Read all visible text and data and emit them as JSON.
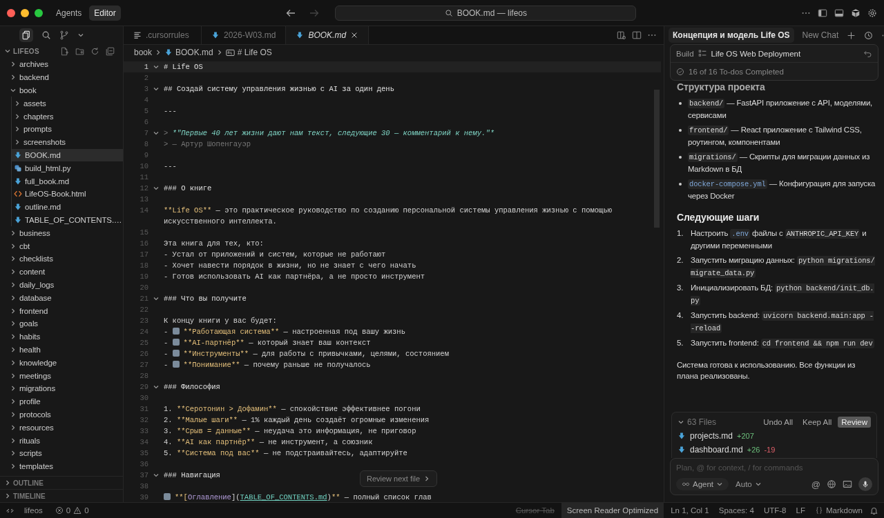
{
  "titlebar": {
    "modes": [
      {
        "label": "Agents",
        "selected": false
      },
      {
        "label": "Editor",
        "selected": true
      }
    ],
    "search": {
      "value": "BOOK.md — lifeos"
    }
  },
  "sidebar": {
    "root": "LIFEOS",
    "tree": [
      {
        "label": "archives",
        "kind": "folder",
        "expanded": false,
        "selected": false
      },
      {
        "label": "backend",
        "kind": "folder",
        "expanded": false,
        "selected": false
      },
      {
        "label": "book",
        "kind": "folder",
        "expanded": true,
        "selected": false,
        "children": [
          {
            "label": "assets",
            "kind": "folder",
            "expanded": false,
            "selected": false
          },
          {
            "label": "chapters",
            "kind": "folder",
            "expanded": false,
            "selected": false
          },
          {
            "label": "prompts",
            "kind": "folder",
            "expanded": false,
            "selected": false
          },
          {
            "label": "screenshots",
            "kind": "folder",
            "expanded": false,
            "selected": false
          },
          {
            "label": "BOOK.md",
            "kind": "md",
            "selected": true
          },
          {
            "label": "build_html.py",
            "kind": "py",
            "selected": false
          },
          {
            "label": "full_book.md",
            "kind": "md",
            "selected": false
          },
          {
            "label": "LifeOS-Book.html",
            "kind": "html",
            "selected": false
          },
          {
            "label": "outline.md",
            "kind": "md",
            "selected": false
          },
          {
            "label": "TABLE_OF_CONTENTS.…",
            "kind": "md",
            "selected": false
          }
        ]
      },
      {
        "label": "business",
        "kind": "folder",
        "expanded": false,
        "selected": false
      },
      {
        "label": "cbt",
        "kind": "folder",
        "expanded": false,
        "selected": false
      },
      {
        "label": "checklists",
        "kind": "folder",
        "expanded": false,
        "selected": false
      },
      {
        "label": "content",
        "kind": "folder",
        "expanded": false,
        "selected": false
      },
      {
        "label": "daily_logs",
        "kind": "folder",
        "expanded": false,
        "selected": false
      },
      {
        "label": "database",
        "kind": "folder",
        "expanded": false,
        "selected": false
      },
      {
        "label": "frontend",
        "kind": "folder",
        "expanded": false,
        "selected": false
      },
      {
        "label": "goals",
        "kind": "folder",
        "expanded": false,
        "selected": false
      },
      {
        "label": "habits",
        "kind": "folder",
        "expanded": false,
        "selected": false
      },
      {
        "label": "health",
        "kind": "folder",
        "expanded": false,
        "selected": false
      },
      {
        "label": "knowledge",
        "kind": "folder",
        "expanded": false,
        "selected": false
      },
      {
        "label": "meetings",
        "kind": "folder",
        "expanded": false,
        "selected": false
      },
      {
        "label": "migrations",
        "kind": "folder",
        "expanded": false,
        "selected": false
      },
      {
        "label": "profile",
        "kind": "folder",
        "expanded": false,
        "selected": false
      },
      {
        "label": "protocols",
        "kind": "folder",
        "expanded": false,
        "selected": false
      },
      {
        "label": "resources",
        "kind": "folder",
        "expanded": false,
        "selected": false
      },
      {
        "label": "rituals",
        "kind": "folder",
        "expanded": false,
        "selected": false
      },
      {
        "label": "scripts",
        "kind": "folder",
        "expanded": false,
        "selected": false
      },
      {
        "label": "templates",
        "kind": "folder",
        "expanded": false,
        "selected": false
      }
    ],
    "sections": [
      {
        "label": "OUTLINE",
        "expanded": false
      },
      {
        "label": "TIMELINE",
        "expanded": false
      }
    ]
  },
  "editor": {
    "tabs": [
      {
        "label": ".cursorrules",
        "kind": "text",
        "selected": false
      },
      {
        "label": "2026-W03.md",
        "kind": "md",
        "selected": false
      },
      {
        "label": "BOOK.md",
        "kind": "md",
        "selected": true
      }
    ],
    "breadcrumb": [
      {
        "label": "book",
        "kind": "folder"
      },
      {
        "label": "BOOK.md",
        "kind": "md"
      },
      {
        "label": "# Life OS",
        "kind": "symbol"
      }
    ],
    "lines": [
      {
        "number": "1",
        "fold": true,
        "current": true,
        "segments": [
          {
            "kind": "heading",
            "text": "# Life OS"
          }
        ]
      },
      {
        "number": "2",
        "fold": false,
        "current": false
      },
      {
        "number": "3",
        "fold": true,
        "current": false,
        "segments": [
          {
            "kind": "heading",
            "text": "## Создай систему управления жизнью с AI за один день"
          }
        ]
      },
      {
        "number": "4",
        "fold": false,
        "current": false
      },
      {
        "number": "5",
        "fold": false,
        "current": false,
        "segments": [
          {
            "kind": "text",
            "text": "---"
          }
        ]
      },
      {
        "number": "6",
        "fold": false,
        "current": false
      },
      {
        "number": "7",
        "fold": true,
        "current": false,
        "segments": [
          {
            "kind": "dim",
            "text": "> "
          },
          {
            "kind": "quote",
            "text": "*\"Первые 40 лет жизни дают нам текст, следующие 30 — комментарий к нему.\"*"
          }
        ]
      },
      {
        "number": "8",
        "fold": false,
        "current": false,
        "segments": [
          {
            "kind": "dim",
            "text": "> — Артур Шопенгауэр"
          }
        ]
      },
      {
        "number": "9",
        "fold": false,
        "current": false
      },
      {
        "number": "10",
        "fold": false,
        "current": false,
        "segments": [
          {
            "kind": "text",
            "text": "---"
          }
        ]
      },
      {
        "number": "11",
        "fold": false,
        "current": false
      },
      {
        "number": "12",
        "fold": true,
        "current": false,
        "segments": [
          {
            "kind": "heading",
            "text": "### О книге"
          }
        ]
      },
      {
        "number": "13",
        "fold": false,
        "current": false
      },
      {
        "number": "14",
        "fold": false,
        "current": false,
        "segments": [
          {
            "kind": "bold",
            "text": "**Life OS**"
          },
          {
            "kind": "text",
            "text": " — это практическое руководство по созданию персональной системы управления жизнью с помощью искусственного интеллекта."
          }
        ]
      },
      {
        "number": "15",
        "fold": false,
        "current": false
      },
      {
        "number": "16",
        "fold": false,
        "current": false,
        "segments": [
          {
            "kind": "text",
            "text": "Эта книга для тех, кто:"
          }
        ]
      },
      {
        "number": "17",
        "fold": false,
        "current": false,
        "segments": [
          {
            "kind": "text",
            "text": "- Устал от приложений и систем, которые не работают"
          }
        ]
      },
      {
        "number": "18",
        "fold": false,
        "current": false,
        "segments": [
          {
            "kind": "text",
            "text": "- Хочет навести порядок в жизни, но не знает с чего начать"
          }
        ]
      },
      {
        "number": "19",
        "fold": false,
        "current": false,
        "segments": [
          {
            "kind": "text",
            "text": "- Готов использовать AI как партнёра, а не просто инструмент"
          }
        ]
      },
      {
        "number": "20",
        "fold": false,
        "current": false
      },
      {
        "number": "21",
        "fold": true,
        "current": false,
        "segments": [
          {
            "kind": "heading",
            "text": "### Что вы получите"
          }
        ]
      },
      {
        "number": "22",
        "fold": false,
        "current": false
      },
      {
        "number": "23",
        "fold": false,
        "current": false,
        "segments": [
          {
            "kind": "text",
            "text": "К концу книги у вас будет:"
          }
        ]
      },
      {
        "number": "24",
        "fold": false,
        "current": false,
        "segments": [
          {
            "kind": "text",
            "text": "- "
          },
          {
            "kind": "icon"
          },
          {
            "kind": "bold",
            "text": "**Работающая система**"
          },
          {
            "kind": "text",
            "text": " — настроенная под вашу жизнь"
          }
        ]
      },
      {
        "number": "25",
        "fold": false,
        "current": false,
        "segments": [
          {
            "kind": "text",
            "text": "- "
          },
          {
            "kind": "icon"
          },
          {
            "kind": "bold",
            "text": "**AI-партнёр**"
          },
          {
            "kind": "text",
            "text": " — который знает ваш контекст"
          }
        ]
      },
      {
        "number": "26",
        "fold": false,
        "current": false,
        "segments": [
          {
            "kind": "text",
            "text": "- "
          },
          {
            "kind": "icon"
          },
          {
            "kind": "bold",
            "text": "**Инструменты**"
          },
          {
            "kind": "text",
            "text": " — для работы с привычками, целями, состоянием"
          }
        ]
      },
      {
        "number": "27",
        "fold": false,
        "current": false,
        "segments": [
          {
            "kind": "text",
            "text": "- "
          },
          {
            "kind": "icon"
          },
          {
            "kind": "bold",
            "text": "**Понимание**"
          },
          {
            "kind": "text",
            "text": " — почему раньше не получалось"
          }
        ]
      },
      {
        "number": "28",
        "fold": false,
        "current": false
      },
      {
        "number": "29",
        "fold": true,
        "current": false,
        "segments": [
          {
            "kind": "heading",
            "text": "### Философия"
          }
        ]
      },
      {
        "number": "30",
        "fold": false,
        "current": false
      },
      {
        "number": "31",
        "fold": false,
        "current": false,
        "segments": [
          {
            "kind": "text",
            "text": "1. "
          },
          {
            "kind": "bold",
            "text": "**Серотонин > Дофамин**"
          },
          {
            "kind": "text",
            "text": " — спокойствие эффективнее погони"
          }
        ]
      },
      {
        "number": "32",
        "fold": false,
        "current": false,
        "segments": [
          {
            "kind": "text",
            "text": "2. "
          },
          {
            "kind": "bold",
            "text": "**Малые шаги**"
          },
          {
            "kind": "text",
            "text": " — 1% каждый день создаёт огромные изменения"
          }
        ]
      },
      {
        "number": "33",
        "fold": false,
        "current": false,
        "segments": [
          {
            "kind": "text",
            "text": "3. "
          },
          {
            "kind": "bold",
            "text": "**Срыв = данные**"
          },
          {
            "kind": "text",
            "text": " — неудача это информация, не приговор"
          }
        ]
      },
      {
        "number": "34",
        "fold": false,
        "current": false,
        "segments": [
          {
            "kind": "text",
            "text": "4. "
          },
          {
            "kind": "bold",
            "text": "**AI как партнёр**"
          },
          {
            "kind": "text",
            "text": " — не инструмент, а союзник"
          }
        ]
      },
      {
        "number": "35",
        "fold": false,
        "current": false,
        "segments": [
          {
            "kind": "text",
            "text": "5. "
          },
          {
            "kind": "bold",
            "text": "**Система под вас**"
          },
          {
            "kind": "text",
            "text": " — не подстраивайтесь, адаптируйте"
          }
        ]
      },
      {
        "number": "36",
        "fold": false,
        "current": false
      },
      {
        "number": "37",
        "fold": true,
        "current": false,
        "segments": [
          {
            "kind": "heading",
            "text": "### Навигация"
          }
        ]
      },
      {
        "number": "38",
        "fold": false,
        "current": false
      },
      {
        "number": "39",
        "fold": false,
        "current": false,
        "segments": [
          {
            "kind": "icon"
          },
          {
            "kind": "bold",
            "text": "**["
          },
          {
            "kind": "link",
            "text": "Оглавление"
          },
          {
            "kind": "text",
            "text": "]("
          },
          {
            "kind": "url",
            "text": "TABLE_OF_CONTENTS.md"
          },
          {
            "kind": "text",
            "text": ")"
          },
          {
            "kind": "bold",
            "text": "**"
          },
          {
            "kind": "text",
            "text": " — полный список глав"
          }
        ]
      }
    ],
    "review_button": {
      "label": "Review next file"
    }
  },
  "chat": {
    "tabs": [
      {
        "label": "Концепция и модель Life OS",
        "selected": true
      },
      {
        "label": "New Chat",
        "selected": false
      }
    ],
    "plan": {
      "mode": "Build",
      "title": "Life OS Web Deployment",
      "todos": "16 of 16 To-dos Completed"
    },
    "blocks": [
      {
        "kind": "heading",
        "text": "Структура проекта"
      },
      {
        "kind": "bullets",
        "items": [
          {
            "segments": [
              {
                "kind": "code",
                "text": "backend/"
              },
              {
                "kind": "text",
                "text": " — FastAPI приложение с API, моделями, сервисами"
              }
            ]
          },
          {
            "segments": [
              {
                "kind": "code",
                "text": "frontend/"
              },
              {
                "kind": "text",
                "text": " — React приложение с Tailwind CSS, роутингом, компонентами"
              }
            ]
          },
          {
            "segments": [
              {
                "kind": "code",
                "text": "migrations/"
              },
              {
                "kind": "text",
                "text": " — Скрипты для миграции данных из Markdown в БД"
              }
            ]
          },
          {
            "segments": [
              {
                "kind": "codelink",
                "text": "docker-compose.yml"
              },
              {
                "kind": "text",
                "text": " — Конфигурация для запуска через Docker"
              }
            ]
          }
        ]
      },
      {
        "kind": "heading",
        "text": "Следующие шаги"
      },
      {
        "kind": "ordered",
        "items": [
          {
            "marker": "1.",
            "segments": [
              {
                "kind": "text",
                "text": "Настроить "
              },
              {
                "kind": "codelink",
                "text": ".env"
              },
              {
                "kind": "text",
                "text": " файлы с "
              },
              {
                "kind": "code",
                "text": "ANTHROPIC_API_KEY"
              },
              {
                "kind": "text",
                "text": " и другими переменными"
              }
            ]
          },
          {
            "marker": "2.",
            "segments": [
              {
                "kind": "text",
                "text": "Запустить миграцию данных: "
              },
              {
                "kind": "code",
                "text": "python migrations/migrate_data.py"
              }
            ]
          },
          {
            "marker": "3.",
            "segments": [
              {
                "kind": "text",
                "text": "Инициализировать БД: "
              },
              {
                "kind": "code",
                "text": "python backend/init_db.py"
              }
            ]
          },
          {
            "marker": "4.",
            "segments": [
              {
                "kind": "text",
                "text": "Запустить backend: "
              },
              {
                "kind": "code",
                "text": "uvicorn backend.main:app --reload"
              }
            ]
          },
          {
            "marker": "5.",
            "segments": [
              {
                "kind": "text",
                "text": "Запустить frontend: "
              },
              {
                "kind": "code",
                "text": "cd frontend && npm run dev"
              }
            ]
          }
        ]
      },
      {
        "kind": "paragraph",
        "text": "Система готова к использованию. Все функции из плана реализованы."
      }
    ],
    "changes": {
      "count": "63 Files",
      "actions": [
        {
          "label": "Undo All",
          "selected": false
        },
        {
          "label": "Keep All",
          "selected": false
        },
        {
          "label": "Review",
          "selected": true
        }
      ],
      "files": [
        {
          "name": "projects.md",
          "added": "+207"
        },
        {
          "name": "dashboard.md",
          "added": "+26",
          "removed": "-19"
        }
      ]
    },
    "composer": {
      "placeholder": "Plan, @ for context, / for commands",
      "agent": "Agent",
      "model": "Auto",
      "mention": "@"
    }
  },
  "status_bar": {
    "workspace": "lifeos",
    "errors": "0",
    "warnings": "0",
    "items": [
      {
        "label": "Cursor Tab",
        "kind": "disabled"
      },
      {
        "label": "Screen Reader Optimized",
        "kind": "highlight"
      },
      {
        "label": "Ln 1, Col 1",
        "kind": "plain"
      },
      {
        "label": "Spaces: 4",
        "kind": "plain"
      },
      {
        "label": "UTF-8",
        "kind": "plain"
      },
      {
        "label": "LF",
        "kind": "plain"
      },
      {
        "label": "Markdown",
        "kind": "language"
      }
    ]
  }
}
